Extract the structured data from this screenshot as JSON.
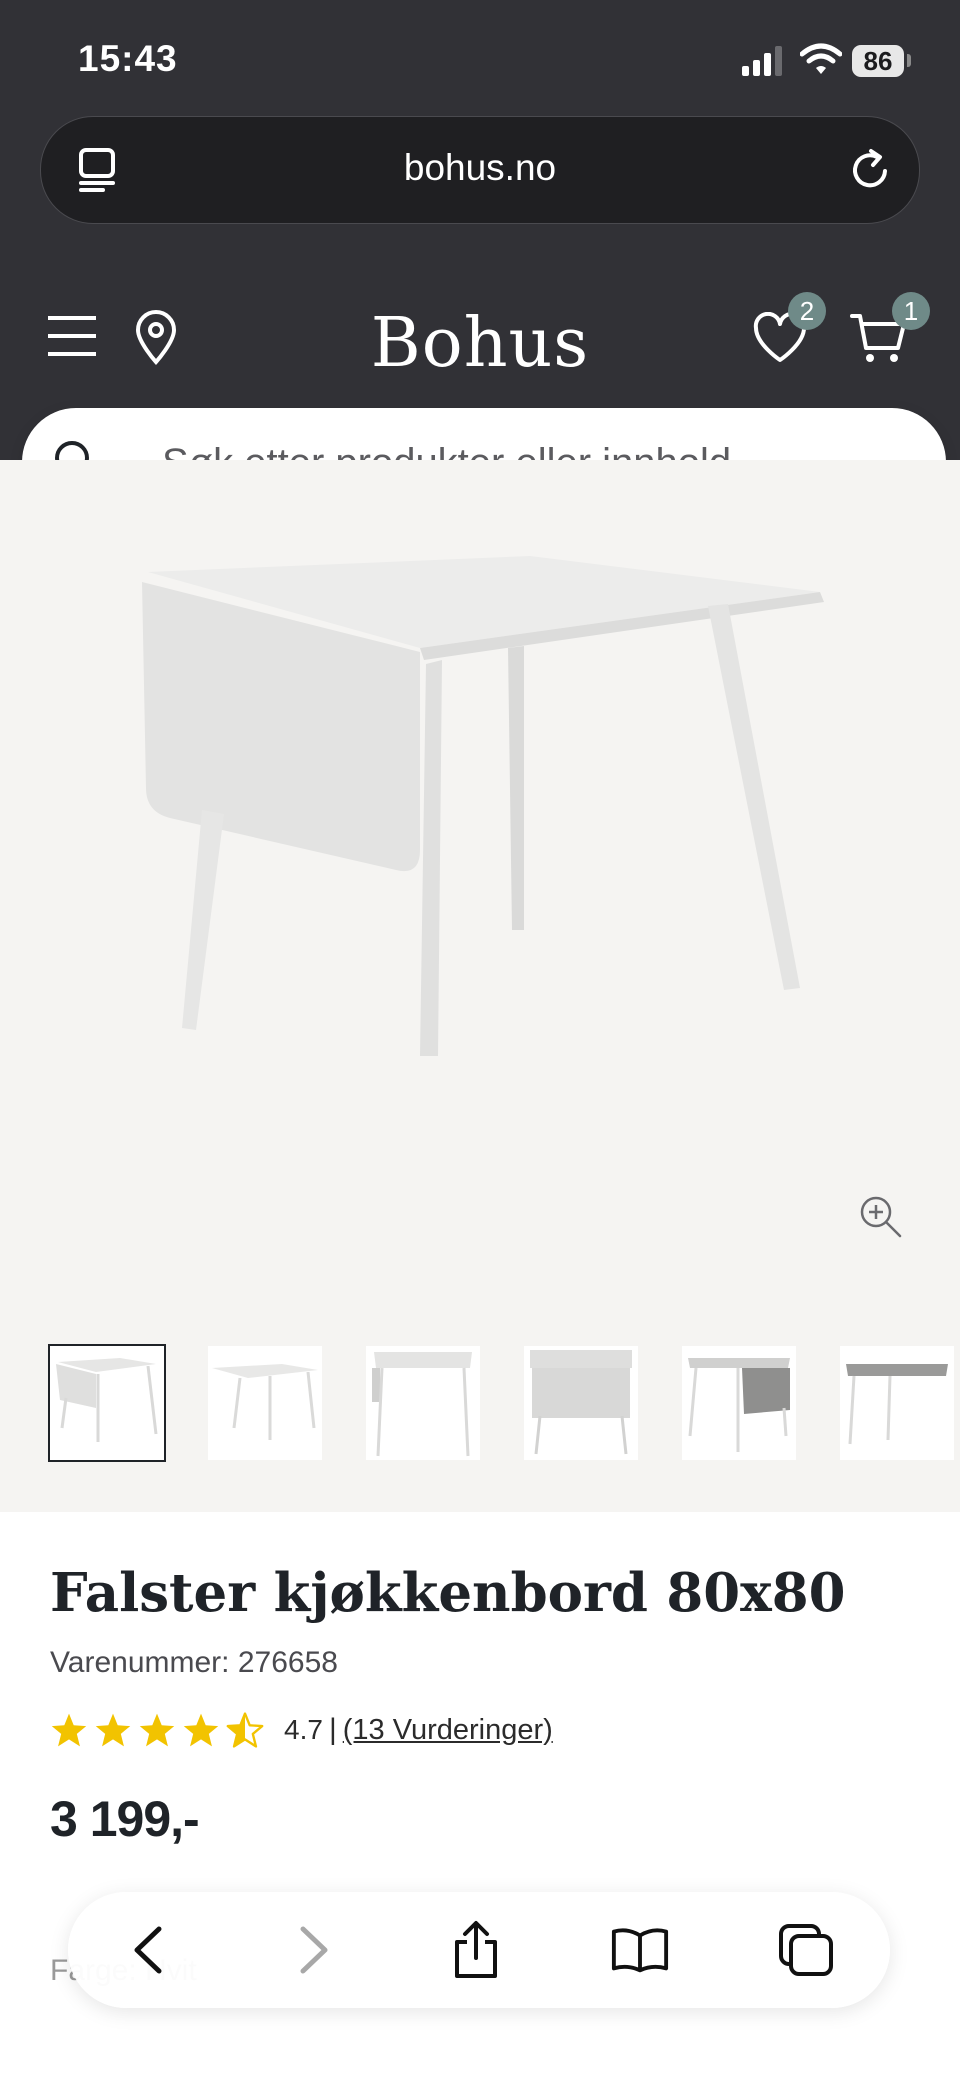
{
  "status_bar": {
    "time": "15:43",
    "battery": "86"
  },
  "browser": {
    "url": "bohus.no"
  },
  "site_header": {
    "logo": "Bohus",
    "wishlist_count": "2",
    "cart_count": "1"
  },
  "search": {
    "placeholder": "Søk etter produkter eller innhold ..."
  },
  "gallery": {
    "thumbnail_count": 6,
    "selected_index": 0
  },
  "product": {
    "title": "Falster kjøkkenbord 80x80",
    "sku": "Varenummer: 276658",
    "rating": "4.7",
    "rating_stars": 4.5,
    "rating_separator": "|",
    "rating_link": "(13 Vurderinger)",
    "price": "3 199,-",
    "color_label": "Farge: Hvit"
  },
  "colors": {
    "header_bg": "#313136",
    "badge": "#6f8a88",
    "star": "#f2c300",
    "gallery_bg": "#f5f4f2"
  },
  "icons": [
    "tabs-icon",
    "reload-icon",
    "menu-icon",
    "location-icon",
    "heart-icon",
    "cart-icon",
    "search-icon",
    "zoom-in-icon",
    "star-icon",
    "back-icon",
    "forward-icon",
    "share-icon",
    "bookmarks-icon",
    "tabs-overview-icon"
  ]
}
